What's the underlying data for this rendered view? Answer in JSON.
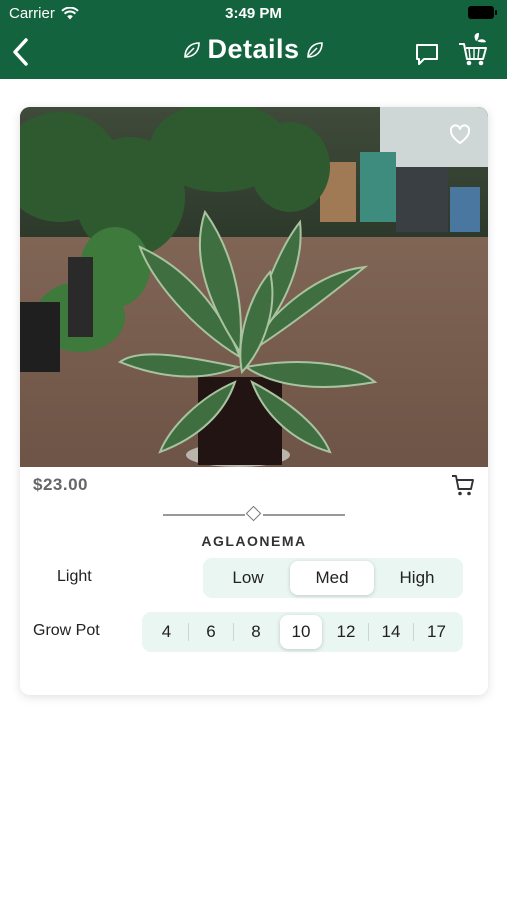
{
  "status_bar": {
    "carrier": "Carrier",
    "time": "3:49 PM"
  },
  "header": {
    "title": "Details",
    "background_color": "#14633f"
  },
  "product": {
    "price": "$23.00",
    "name": "AGLAONEMA",
    "is_favorite": false
  },
  "light": {
    "label": "Light",
    "options": [
      "Low",
      "Med",
      "High"
    ],
    "selected": "Med"
  },
  "grow_pot": {
    "label": "Grow Pot",
    "options": [
      "4",
      "6",
      "8",
      "10",
      "12",
      "14",
      "17"
    ],
    "selected": "10"
  },
  "colors": {
    "accent": "#14633f",
    "segment_bg": "#eaf6f2",
    "price_text": "#666666"
  }
}
